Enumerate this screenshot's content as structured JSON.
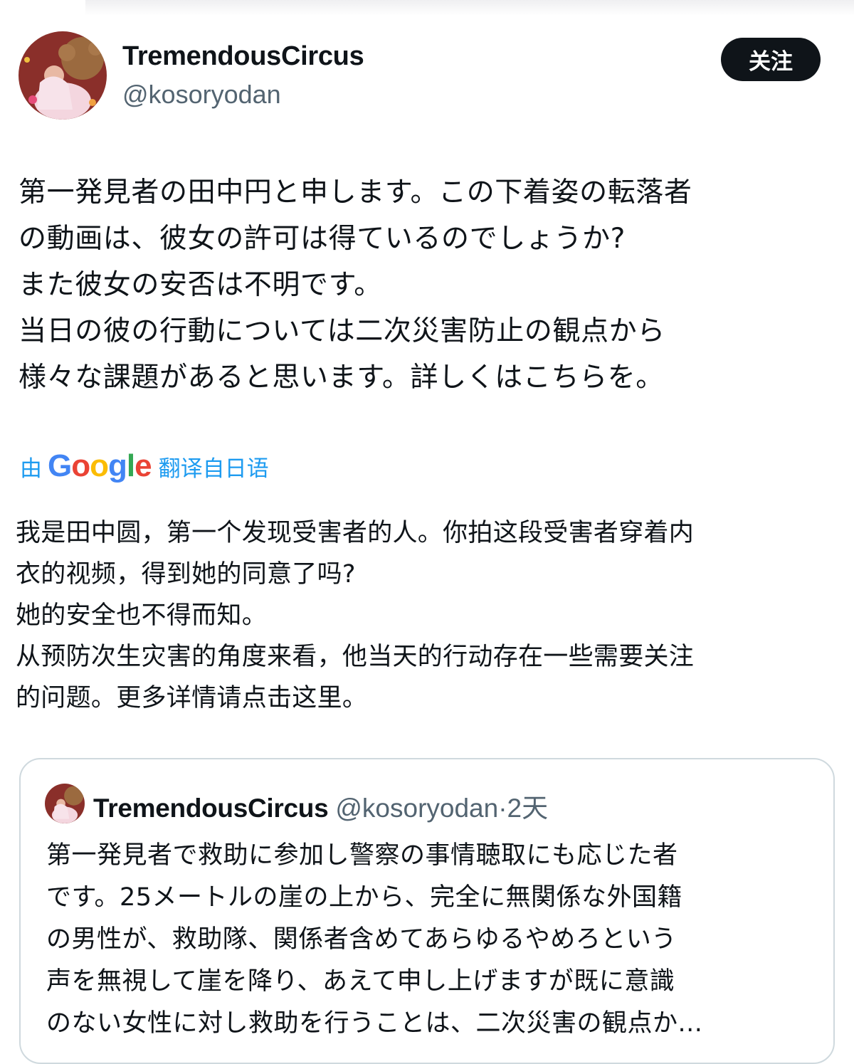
{
  "author": {
    "name": "TremendousCircus",
    "handle": "@kosoryodan",
    "follow_label": "关注"
  },
  "tweet": {
    "lines": [
      "第一発見者の田中円と申します。この下着姿の転落者",
      "の動画は、彼女の許可は得ているのでしょうか?",
      "また彼女の安否は不明です。",
      "当日の彼の行動については二次災害防止の観点から",
      "様々な課題があると思います。詳しくはこちらを。"
    ]
  },
  "translation": {
    "prefix": "由",
    "provider": "Google",
    "suffix": "翻译自日语",
    "lines": [
      "我是田中圆，第一个发现受害者的人。你拍这段受害者穿着内",
      "衣的视频，得到她的同意了吗?",
      "她的安全也不得而知。",
      "从预防次生灾害的角度来看，他当天的行动存在一些需要关注",
      "的问题。更多详情请点击这里。"
    ]
  },
  "quote": {
    "name": "TremendousCircus",
    "handle": "@kosoryodan",
    "time": "·2天",
    "lines": [
      "第一発見者で救助に参加し警察の事情聴取にも応じた者",
      "です。25メートルの崖の上から、完全に無関係な外国籍",
      "の男性が、救助隊、関係者含めてあらゆるやめろという",
      "声を無視して崖を降り、あえて申し上げますが既に意識",
      "のない女性に対し救助を行うことは、二次災害の観点か..."
    ]
  },
  "colors": {
    "text": "#0f1419",
    "muted": "#536471",
    "link": "#1d9bf0",
    "button_bg": "#0f1419",
    "border": "#cfd9de"
  }
}
